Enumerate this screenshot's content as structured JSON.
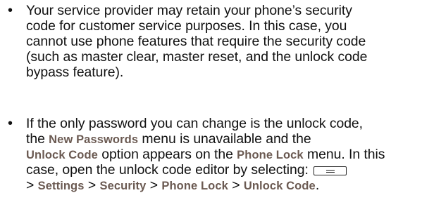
{
  "bullets": [
    {
      "symbol": "•",
      "lines": [
        "Your service provider may retain your phone’s security",
        "code for customer service purposes. In this case, you",
        "cannot use phone features that require the security code",
        "(such as master clear, master reset, and the unlock code",
        "bypass feature)."
      ]
    },
    {
      "symbol": "•",
      "line1": "If the only password you can change is the unlock code,",
      "line2_pre": "the ",
      "line2_kw": "New Passwords",
      "line2_post": " menu is unavailable and the",
      "line3_kw1": "Unlock Code",
      "line3_mid": " option appears on the ",
      "line3_kw2": "Phone Lock",
      "line3_post": " menu. In this",
      "line4_text": "case, open the unlock code editor by selecting:",
      "menu_key_icon": "menu-key-icon",
      "path_sep": ">",
      "path": [
        "Settings",
        "Security",
        "Phone Lock",
        "Unlock Code"
      ],
      "path_end": "."
    }
  ]
}
